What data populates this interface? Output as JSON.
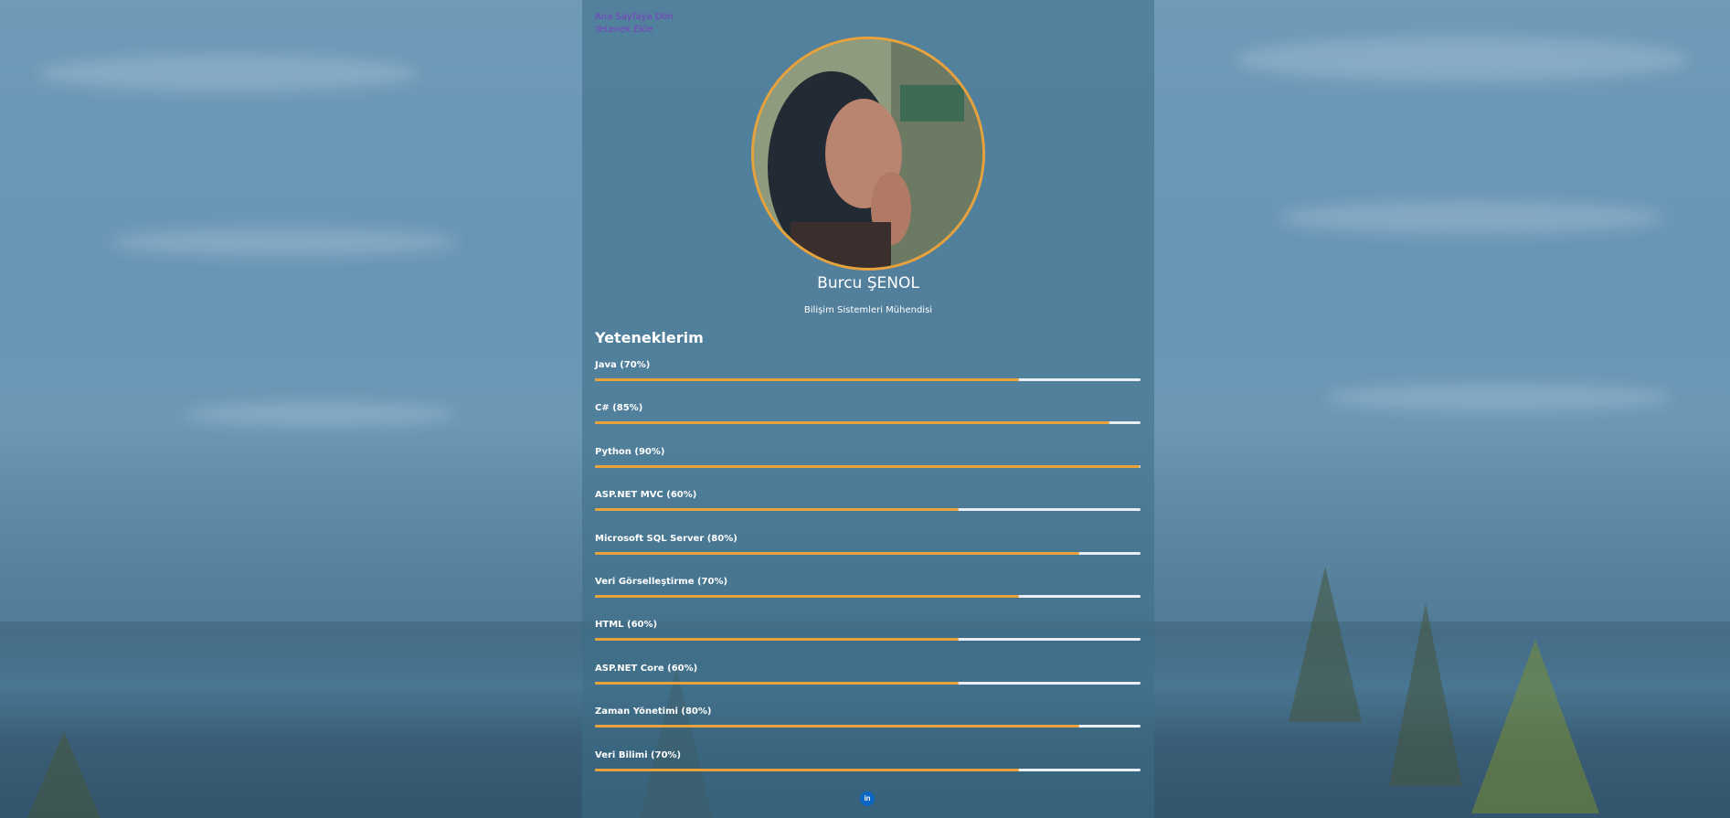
{
  "nav": {
    "home_link": "Ana Sayfaya Dön",
    "add_skill_link": "Yetenek Ekle"
  },
  "profile": {
    "name": "Burcu ŞENOL",
    "title": "Bilişim Sistemleri Mühendisi"
  },
  "skills_section": {
    "heading": "Yeteneklerim",
    "items": [
      {
        "label": "Java (70%)",
        "level": 0.7
      },
      {
        "label": "C# (85%)",
        "level": 0.85
      },
      {
        "label": "Python (90%)",
        "level": 0.9
      },
      {
        "label": "ASP.NET MVC (60%)",
        "level": 0.6
      },
      {
        "label": "Microsoft SQL Server (80%)",
        "level": 0.8
      },
      {
        "label": "Veri Görselleştirme (70%)",
        "level": 0.7
      },
      {
        "label": "HTML (60%)",
        "level": 0.6
      },
      {
        "label": "ASP.NET Core (60%)",
        "level": 0.6
      },
      {
        "label": "Zaman Yönetimi (80%)",
        "level": 0.8
      },
      {
        "label": "Veri Bilimi (70%)",
        "level": 0.7
      }
    ]
  },
  "social": {
    "linkedin_glyph": "in",
    "icon": "linkedin-icon"
  },
  "colors": {
    "accent": "#e8a23c",
    "link": "#7b3fc0",
    "bar_track": "#e8eef2",
    "linkedin": "#0a66c2"
  }
}
